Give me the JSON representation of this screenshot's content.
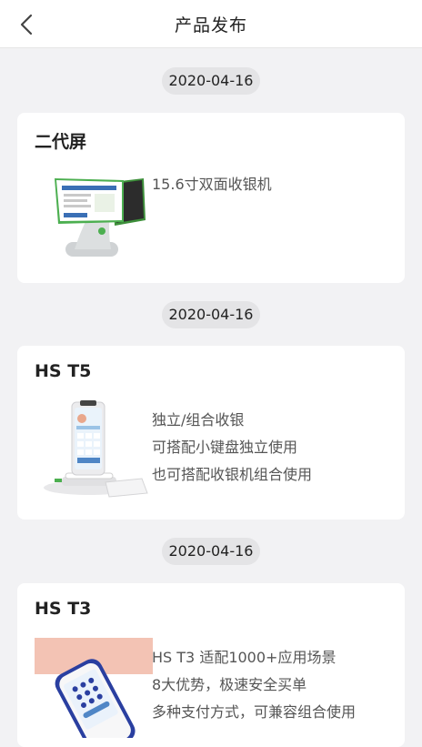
{
  "header": {
    "title": "产品发布",
    "back_icon": "chevron-left-icon"
  },
  "products": [
    {
      "date": "2020-04-16",
      "name": "二代屏",
      "image_icon": "dual-screen-pos-image",
      "lines": [
        "15.6寸双面收银机"
      ]
    },
    {
      "date": "2020-04-16",
      "name": "HS T5",
      "image_icon": "tablet-pos-with-keypad-image",
      "lines": [
        "独立/组合收银",
        "可搭配小键盘独立使用",
        "也可搭配收银机组合使用"
      ]
    },
    {
      "date": "2020-04-16",
      "name": "HS T3",
      "image_icon": "handheld-pos-image",
      "lines": [
        "HS T3 适配1000+应用场景",
        "8大优势，极速安全买单",
        "多种支付方式，可兼容组合使用"
      ]
    }
  ],
  "colors": {
    "background": "#f2f2f4",
    "card": "#ffffff",
    "date_pill": "#e4e4e6",
    "device_green_accent": "#4caf50",
    "device_blue_accent": "#2a3fa0",
    "photo_backdrop": "#f3c3b4"
  }
}
